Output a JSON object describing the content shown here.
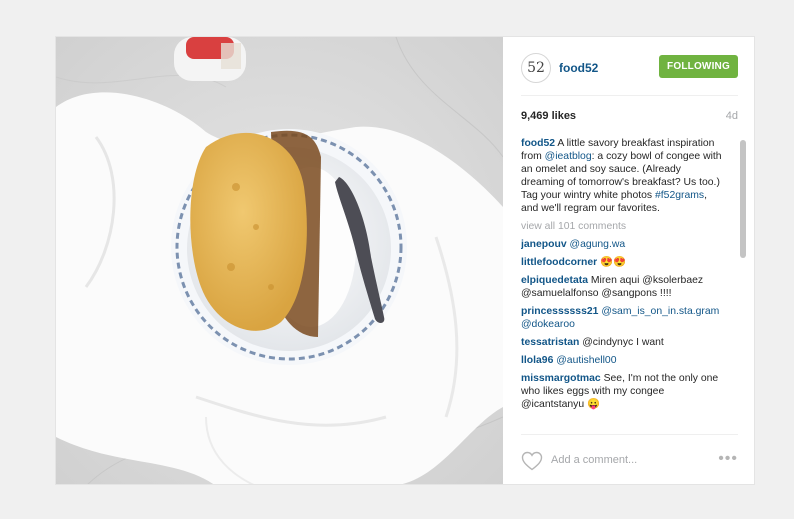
{
  "post": {
    "avatar_text": "52",
    "username": "food52",
    "follow_label": "FOLLOWING",
    "likes": "9,469 likes",
    "time_ago": "4d",
    "caption": {
      "user": "food52",
      "text_1": " A little savory breakfast inspiration from ",
      "mention_1": "@ieatblog",
      "text_2": ": a cozy bowl of congee with an omelet and soy sauce. (Already dreaming of tomorrow's breakfast? Us too.) Tag your wintry white photos ",
      "hashtag": "#f52grams",
      "text_3": ", and we'll regram our favorites."
    },
    "view_all": "view all 101 comments",
    "comments": [
      {
        "user": "janepouv",
        "text": "@agung.wa"
      },
      {
        "user": "littlefoodcorner",
        "text": "😍😍"
      },
      {
        "user": "elpiquedetata",
        "text": "Miren aqui @ksolerbaez @samuelalfonso @sangpons !!!!"
      },
      {
        "user": "princessssss21",
        "text": "@sam_is_on_in.sta.gram @dokearoo"
      },
      {
        "user": "tessatristan",
        "text": "@cindynyc I want"
      },
      {
        "user": "llola96",
        "text": "@autishell00"
      },
      {
        "user": "missmargotmac",
        "text": "See, I'm not the only one who likes eggs with my congee @icantstanyu 😛"
      }
    ],
    "comment_placeholder": "Add a comment...",
    "more_label": "•••",
    "colors": {
      "follow_green": "#70b340",
      "username_blue": "#125688",
      "muted_gray": "#a5a7aa"
    },
    "icons": [
      "heart-icon",
      "more-options-icon"
    ]
  }
}
